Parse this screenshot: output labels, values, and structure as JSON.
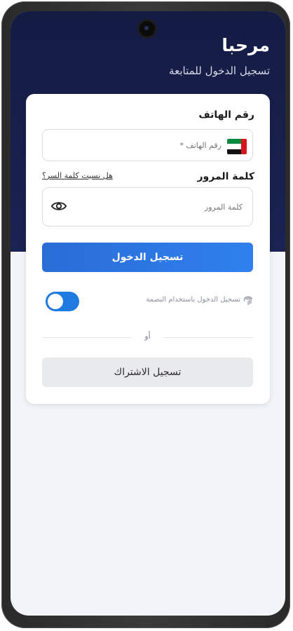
{
  "header": {
    "title": "مرحبا",
    "subtitle": "تسجيل الدخول للمتابعة"
  },
  "phone": {
    "label": "رقم الهاتف",
    "placeholder": "رقم الهاتف *",
    "flag_icon": "uae-flag-icon"
  },
  "password": {
    "label": "كلمة المرور",
    "placeholder": "كلمة المرور",
    "forgot_link": "هل نسيت كلمة السر؟",
    "visibility_icon": "eye-icon"
  },
  "actions": {
    "login_label": "تسجيل الدخول",
    "register_label": "تسجيل الاشتراك",
    "divider_text": "أو"
  },
  "biometric": {
    "label": "تسجيل الدخول باستخدام البصمة",
    "icon": "fingerprint-icon",
    "toggle_on": true
  },
  "colors": {
    "hero": "#141c44",
    "primary": "#2f80ee",
    "toggle": "#1f7be0",
    "background": "#f2f4f9"
  }
}
